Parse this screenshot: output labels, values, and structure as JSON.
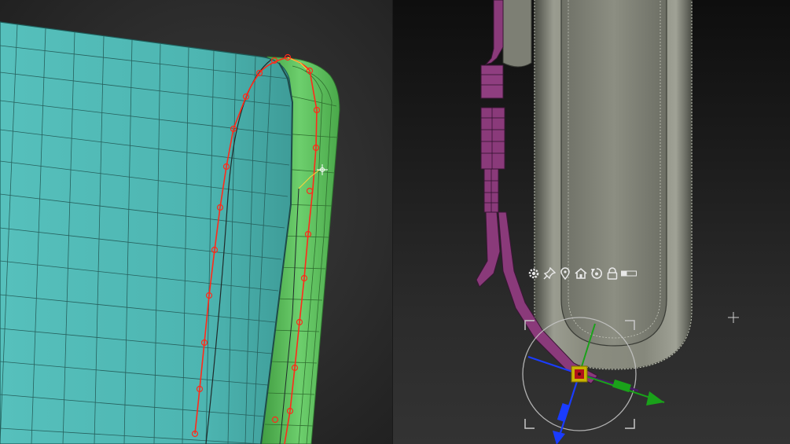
{
  "app": {
    "viewports": [
      "left-viewport",
      "right-viewport"
    ]
  },
  "gizmo": {
    "toolbar_icons": [
      "gear-icon",
      "pin-icon",
      "location-pin-icon",
      "home-icon",
      "rotate-reset-icon",
      "lock-icon",
      "slider-bar-icon"
    ],
    "axis_colors": {
      "x": "#2ecc2e",
      "y": "#1a3cff",
      "z": "#1aa11a"
    },
    "center_color": "#c8b400"
  },
  "colors": {
    "cyan_surface": "#4fb8b4",
    "green_surface": "#5fbf5f",
    "curve_red": "#ff2a1a",
    "strap_magenta": "#8a3a7a",
    "clay_surface": "#8a8c80"
  }
}
